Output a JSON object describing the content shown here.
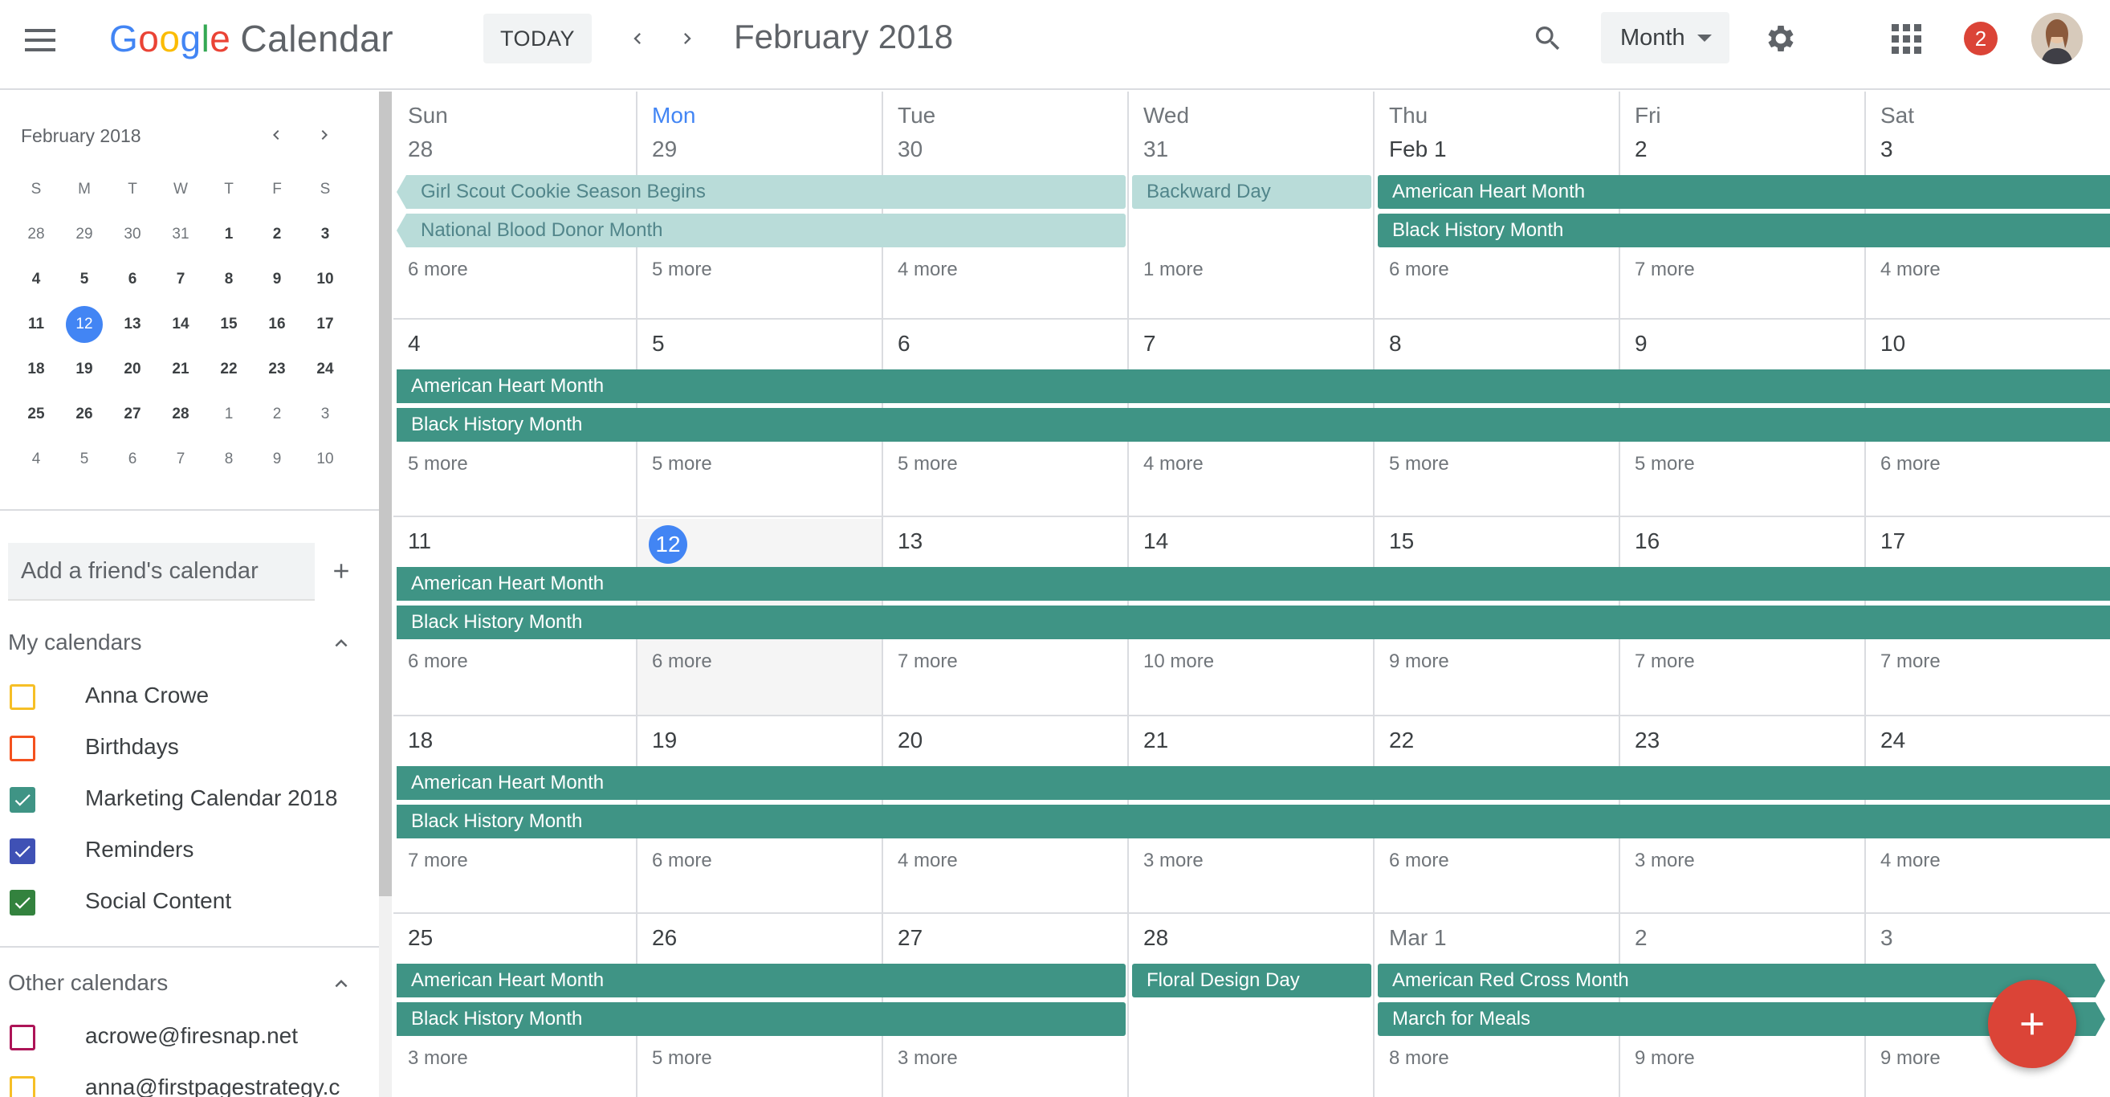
{
  "header": {
    "logo_google": "Google",
    "logo_calendar": "Calendar",
    "today_label": "TODAY",
    "title": "February 2018",
    "view_label": "Month",
    "notification_count": "2"
  },
  "mini_calendar": {
    "title": "February 2018",
    "day_headers": [
      "S",
      "M",
      "T",
      "W",
      "T",
      "F",
      "S"
    ],
    "weeks": [
      [
        {
          "d": "28",
          "o": true
        },
        {
          "d": "29",
          "o": true
        },
        {
          "d": "30",
          "o": true
        },
        {
          "d": "31",
          "o": true
        },
        {
          "d": "1"
        },
        {
          "d": "2"
        },
        {
          "d": "3"
        }
      ],
      [
        {
          "d": "4"
        },
        {
          "d": "5"
        },
        {
          "d": "6"
        },
        {
          "d": "7"
        },
        {
          "d": "8"
        },
        {
          "d": "9"
        },
        {
          "d": "10"
        }
      ],
      [
        {
          "d": "11"
        },
        {
          "d": "12",
          "t": true
        },
        {
          "d": "13"
        },
        {
          "d": "14"
        },
        {
          "d": "15"
        },
        {
          "d": "16"
        },
        {
          "d": "17"
        }
      ],
      [
        {
          "d": "18"
        },
        {
          "d": "19"
        },
        {
          "d": "20"
        },
        {
          "d": "21"
        },
        {
          "d": "22"
        },
        {
          "d": "23"
        },
        {
          "d": "24"
        }
      ],
      [
        {
          "d": "25"
        },
        {
          "d": "26"
        },
        {
          "d": "27"
        },
        {
          "d": "28"
        },
        {
          "d": "1",
          "o": true
        },
        {
          "d": "2",
          "o": true
        },
        {
          "d": "3",
          "o": true
        }
      ],
      [
        {
          "d": "4",
          "o": true
        },
        {
          "d": "5",
          "o": true
        },
        {
          "d": "6",
          "o": true
        },
        {
          "d": "7",
          "o": true
        },
        {
          "d": "8",
          "o": true
        },
        {
          "d": "9",
          "o": true
        },
        {
          "d": "10",
          "o": true
        }
      ]
    ]
  },
  "sidebar": {
    "friend_placeholder": "Add a friend's calendar",
    "my_calendars_title": "My calendars",
    "my_calendars": [
      {
        "label": "Anna Crowe",
        "color": "#f6bf26",
        "checked": false
      },
      {
        "label": "Birthdays",
        "color": "#f4511e",
        "checked": false
      },
      {
        "label": "Marketing Calendar 2018",
        "color": "#3f9485",
        "checked": true
      },
      {
        "label": "Reminders",
        "color": "#3f51b5",
        "checked": true
      },
      {
        "label": "Social Content",
        "color": "#33823e",
        "checked": true
      }
    ],
    "other_calendars_title": "Other calendars",
    "other_calendars": [
      {
        "label": "acrowe@firesnap.net",
        "color": "#ad1457",
        "checked": false
      },
      {
        "label": "anna@firstpagestrategy.c",
        "color": "#f6bf26",
        "checked": false
      }
    ]
  },
  "month": {
    "day_of_week": [
      "Sun",
      "Mon",
      "Tue",
      "Wed",
      "Thu",
      "Fri",
      "Sat"
    ],
    "current_dow_index": 1,
    "weeks": [
      {
        "days": [
          {
            "label": "28",
            "faded": true
          },
          {
            "label": "29",
            "faded": true
          },
          {
            "label": "30",
            "faded": true
          },
          {
            "label": "31",
            "faded": true
          },
          {
            "label": "Feb 1"
          },
          {
            "label": "2"
          },
          {
            "label": "3"
          }
        ],
        "more": [
          "6 more",
          "5 more",
          "4 more",
          "1 more",
          "6 more",
          "7 more",
          "4 more"
        ],
        "events": [
          {
            "title": "Girl Scout Cookie Season Begins",
            "start": 0,
            "end": 2,
            "row": 0,
            "light": true,
            "cont_left": true
          },
          {
            "title": "Backward Day",
            "start": 3,
            "end": 3,
            "row": 0,
            "light": true
          },
          {
            "title": "American Heart Month",
            "start": 4,
            "end": 6,
            "row": 0,
            "cont_right": true
          },
          {
            "title": "National Blood Donor Month",
            "start": 0,
            "end": 2,
            "row": 1,
            "light": true,
            "cont_left": true
          },
          {
            "title": "Black History Month",
            "start": 4,
            "end": 6,
            "row": 1,
            "cont_right": true
          }
        ]
      },
      {
        "days": [
          {
            "label": "4"
          },
          {
            "label": "5"
          },
          {
            "label": "6"
          },
          {
            "label": "7"
          },
          {
            "label": "8"
          },
          {
            "label": "9"
          },
          {
            "label": "10"
          }
        ],
        "more": [
          "5 more",
          "5 more",
          "5 more",
          "4 more",
          "5 more",
          "5 more",
          "6 more"
        ],
        "events": [
          {
            "title": "American Heart Month",
            "start": 0,
            "end": 6,
            "row": 0,
            "cont_left": true,
            "cont_right": true
          },
          {
            "title": "Black History Month",
            "start": 0,
            "end": 6,
            "row": 1,
            "cont_left": true,
            "cont_right": true
          }
        ]
      },
      {
        "days": [
          {
            "label": "11"
          },
          {
            "label": "12",
            "today": true
          },
          {
            "label": "13"
          },
          {
            "label": "14"
          },
          {
            "label": "15"
          },
          {
            "label": "16"
          },
          {
            "label": "17"
          }
        ],
        "more": [
          "6 more",
          "6 more",
          "7 more",
          "10 more",
          "9 more",
          "7 more",
          "7 more"
        ],
        "events": [
          {
            "title": "American Heart Month",
            "start": 0,
            "end": 6,
            "row": 0,
            "cont_left": true,
            "cont_right": true
          },
          {
            "title": "Black History Month",
            "start": 0,
            "end": 6,
            "row": 1,
            "cont_left": true,
            "cont_right": true
          }
        ]
      },
      {
        "days": [
          {
            "label": "18"
          },
          {
            "label": "19"
          },
          {
            "label": "20"
          },
          {
            "label": "21"
          },
          {
            "label": "22"
          },
          {
            "label": "23"
          },
          {
            "label": "24"
          }
        ],
        "more": [
          "7 more",
          "6 more",
          "4 more",
          "3 more",
          "6 more",
          "3 more",
          "4 more"
        ],
        "events": [
          {
            "title": "American Heart Month",
            "start": 0,
            "end": 6,
            "row": 0,
            "cont_left": true,
            "cont_right": true
          },
          {
            "title": "Black History Month",
            "start": 0,
            "end": 6,
            "row": 1,
            "cont_left": true,
            "cont_right": true
          }
        ]
      },
      {
        "days": [
          {
            "label": "25"
          },
          {
            "label": "26"
          },
          {
            "label": "27"
          },
          {
            "label": "28"
          },
          {
            "label": "Mar 1",
            "faded": true
          },
          {
            "label": "2",
            "faded": true
          },
          {
            "label": "3",
            "faded": true
          }
        ],
        "more": [
          "3 more",
          "5 more",
          "3 more",
          "",
          "8 more",
          "9 more",
          "9 more"
        ],
        "events": [
          {
            "title": "American Heart Month",
            "start": 0,
            "end": 2,
            "row": 0,
            "cont_left": true
          },
          {
            "title": "Floral Design Day",
            "start": 3,
            "end": 3,
            "row": 0
          },
          {
            "title": "American Red Cross Month",
            "start": 4,
            "end": 6,
            "row": 0,
            "arrow_right": true
          },
          {
            "title": "Black History Month",
            "start": 0,
            "end": 2,
            "row": 1,
            "cont_left": true
          },
          {
            "title": "March for Meals",
            "start": 4,
            "end": 6,
            "row": 1,
            "arrow_right": true
          }
        ]
      }
    ]
  },
  "colors": {
    "event_teal": "#3f9485",
    "event_light": "#b9dcd9",
    "today_blue": "#4285f4",
    "fab_red": "#db4437"
  },
  "icons": {
    "menu": "hamburger-menu-icon",
    "search": "search-icon",
    "settings": "gear-icon",
    "apps": "apps-grid-icon",
    "add": "plus-icon"
  }
}
